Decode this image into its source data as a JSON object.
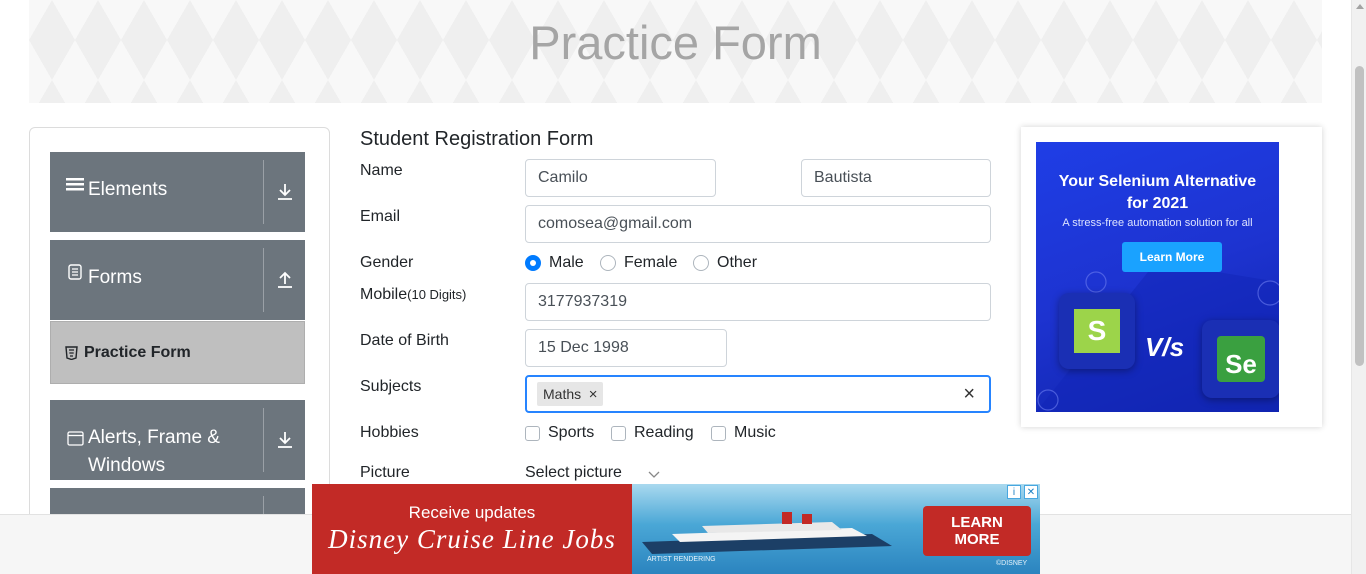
{
  "banner": {
    "title": "Practice Form"
  },
  "sidebar": {
    "groups": [
      {
        "label": "Elements",
        "icon": "hamburger-icon",
        "arrow": "download-arrow-icon"
      },
      {
        "label": "Forms",
        "icon": "document-icon",
        "arrow": "upload-arrow-icon"
      },
      {
        "label": "Alerts, Frame &",
        "label2": "Windows",
        "icon": "window-icon",
        "arrow": "download-arrow-icon"
      }
    ],
    "active_item": {
      "label": "Practice Form",
      "icon": "html5-icon"
    }
  },
  "form": {
    "title": "Student Registration Form",
    "name_label": "Name",
    "first_name": "Camilo",
    "last_name": "Bautista",
    "email_label": "Email",
    "email": "comosea@gmail.com",
    "gender_label": "Gender",
    "gender_options": [
      "Male",
      "Female",
      "Other"
    ],
    "gender_selected": "Male",
    "mobile_label": "Mobile",
    "mobile_hint": "(10 Digits)",
    "mobile": "3177937319",
    "dob_label": "Date of Birth",
    "dob": "15 Dec 1998",
    "subjects_label": "Subjects",
    "subject_chip": "Maths",
    "chip_remove": "×",
    "subjects_clear": "×",
    "hobbies_label": "Hobbies",
    "hobbies": [
      "Sports",
      "Reading",
      "Music"
    ],
    "picture_label": "Picture",
    "picture_button": "Select picture"
  },
  "ad_right": {
    "title_line1": "Your Selenium Alternative",
    "title_line2": "for 2021",
    "subtitle": "A stress-free automation solution for all",
    "button": "Learn More",
    "vs": "V/s",
    "logo_left": "S",
    "logo_right": "Se"
  },
  "ad_bottom": {
    "line1": "Receive updates",
    "brand": "Disney Cruise Line Jobs",
    "cta_line1": "LEARN",
    "cta_line2": "MORE",
    "caption": "ARTIST RENDERING",
    "copyright": "©DISNEY"
  },
  "colors": {
    "sidebar_header": "#6c757d",
    "active_item": "#bfbfbf",
    "focus_border": "#007bff",
    "ad_blue": "#1d33d0",
    "ad_red": "#c22a26"
  }
}
